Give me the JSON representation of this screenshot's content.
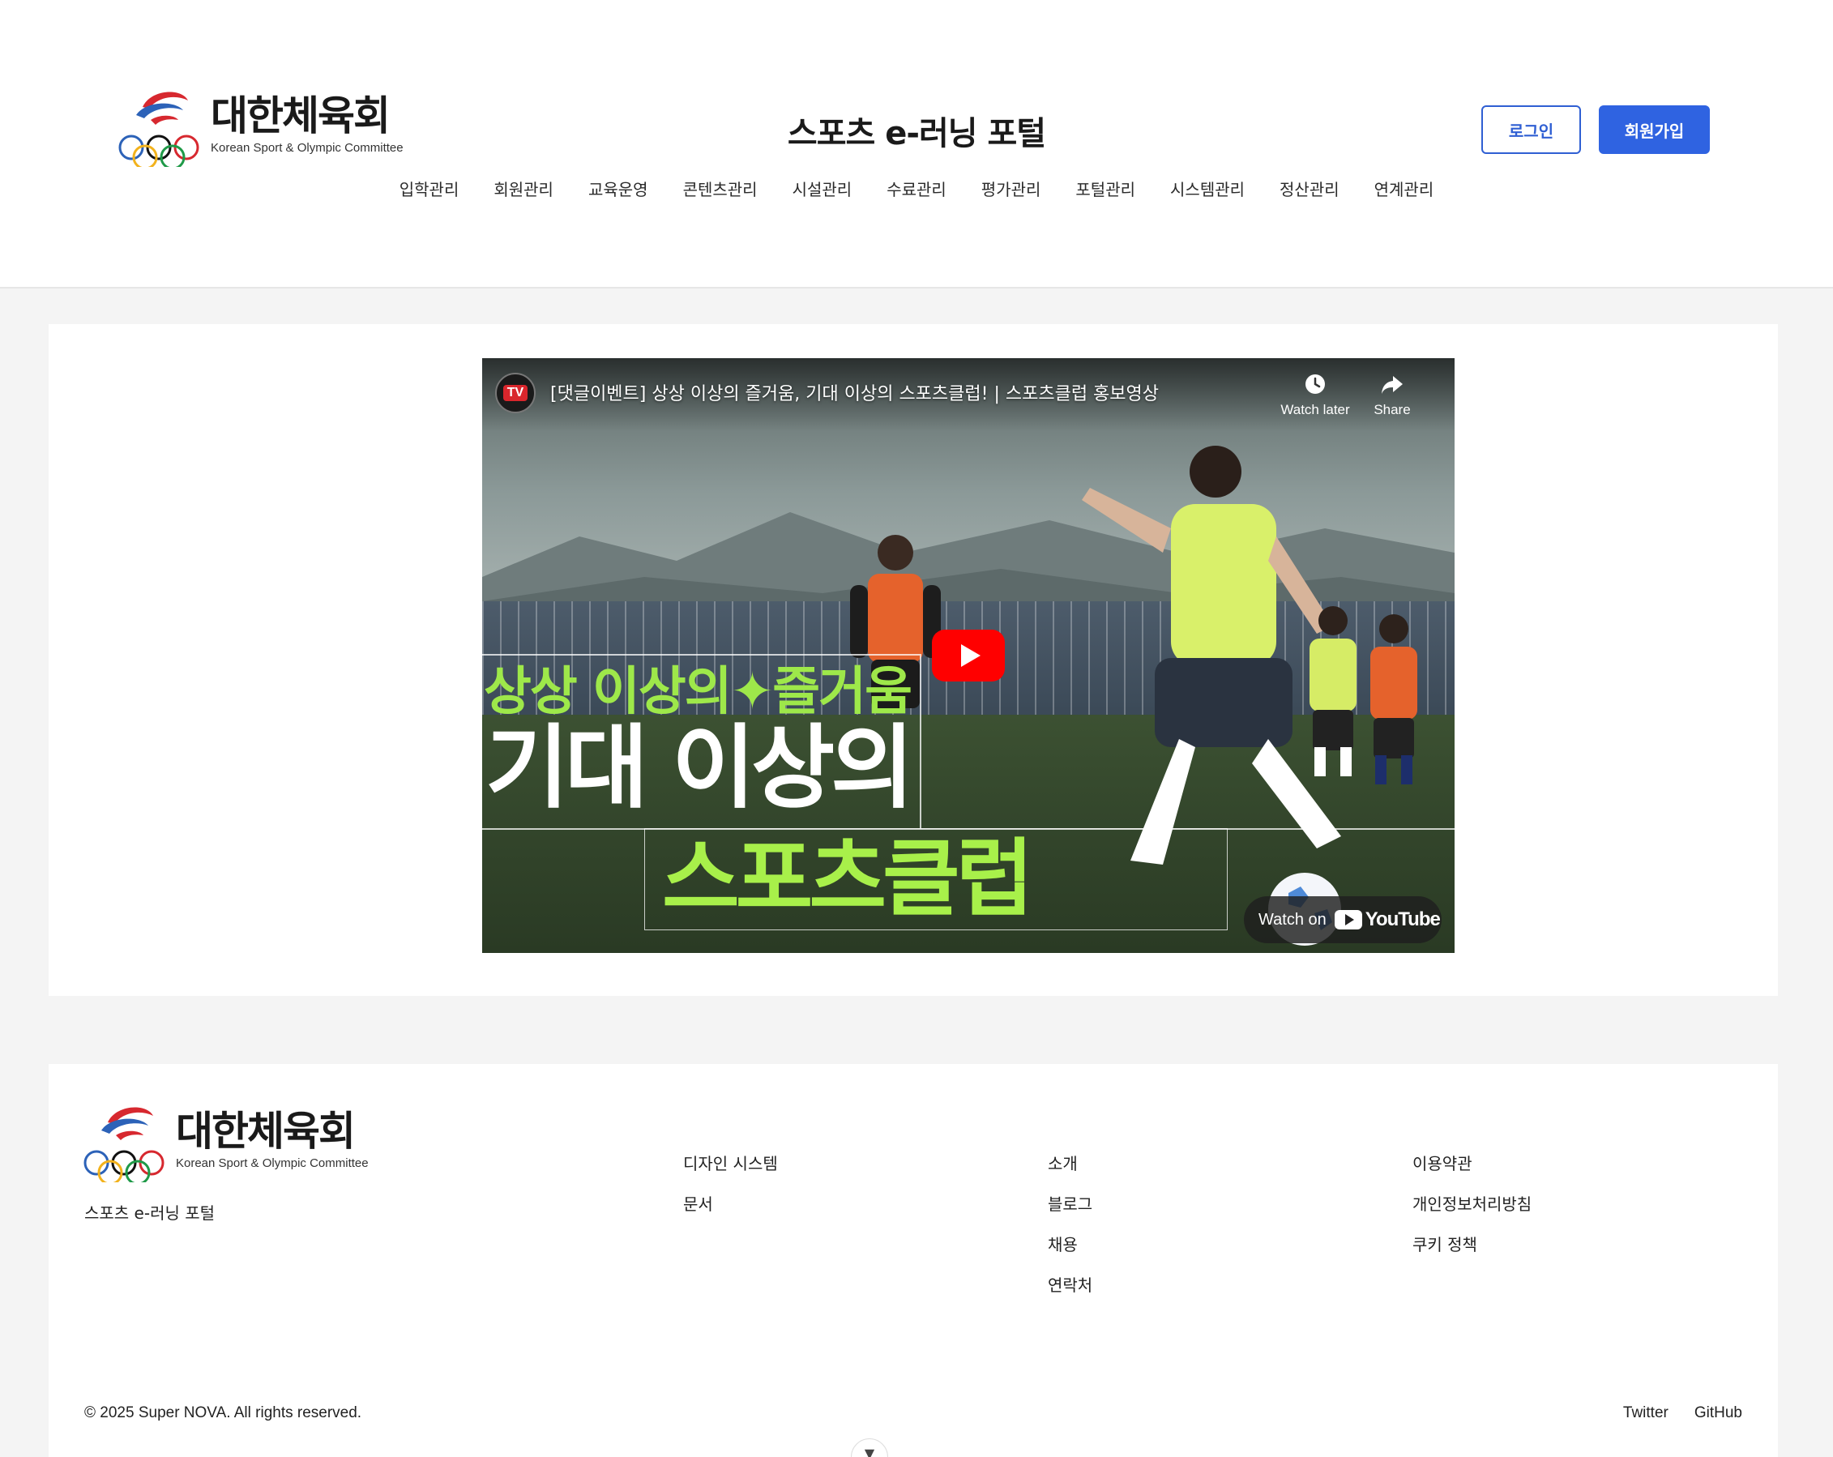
{
  "brand": {
    "name": "대한체육회",
    "subtitle": "Korean Sport & Olympic Committee"
  },
  "header": {
    "site_title": "스포츠 e-러닝 포털",
    "login_label": "로그인",
    "signup_label": "회원가입"
  },
  "nav": {
    "items": [
      {
        "label": "입학관리"
      },
      {
        "label": "회원관리"
      },
      {
        "label": "교육운영"
      },
      {
        "label": "콘텐츠관리"
      },
      {
        "label": "시설관리"
      },
      {
        "label": "수료관리"
      },
      {
        "label": "평가관리"
      },
      {
        "label": "포털관리"
      },
      {
        "label": "시스템관리"
      },
      {
        "label": "정산관리"
      },
      {
        "label": "연계관리"
      }
    ]
  },
  "video": {
    "channel_badge": "TV",
    "title": "[댓글이벤트] 상상 이상의 즐거움, 기대 이상의 스포츠클럽! | 스포츠클럽 홍보영상",
    "watch_later_label": "Watch later",
    "share_label": "Share",
    "overlay_line1": "상상 이상의✦즐거움",
    "overlay_line2": "기대 이상의",
    "overlay_line3": "스포츠클럽",
    "watch_on_label": "Watch on",
    "youtube_label": "YouTube"
  },
  "footer": {
    "tagline": "스포츠 e-러닝 포털",
    "columns": [
      {
        "links": [
          "디자인 시스템",
          "문서"
        ]
      },
      {
        "links": [
          "소개",
          "블로그",
          "채용",
          "연락처"
        ]
      },
      {
        "links": [
          "이용약관",
          "개인정보처리방침",
          "쿠키 정책"
        ]
      }
    ],
    "copyright": "© 2025 Super NOVA. All rights reserved.",
    "social": [
      "Twitter",
      "GitHub"
    ]
  },
  "colors": {
    "primary": "#2f63e1",
    "youtube_red": "#ff0000",
    "overlay_green": "#a8f04a"
  },
  "icons": {
    "watch_later": "clock-icon",
    "share": "share-arrow-icon",
    "play": "play-icon",
    "scroll": "chevron-down-icon"
  }
}
